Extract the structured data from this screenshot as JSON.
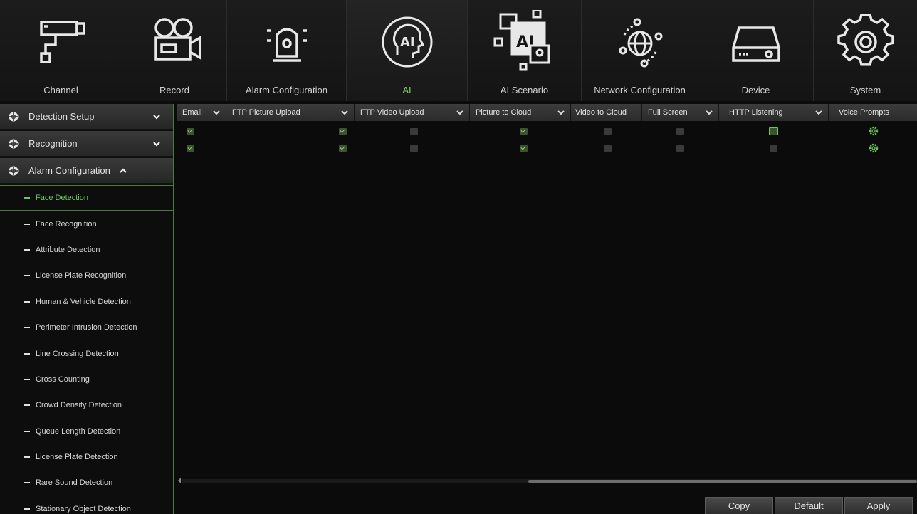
{
  "nav": {
    "items": [
      {
        "label": "Channel",
        "icon": "cctv-camera-icon"
      },
      {
        "label": "Record",
        "icon": "film-camera-icon"
      },
      {
        "label": "Alarm Configuration",
        "icon": "alarm-siren-icon"
      },
      {
        "label": "AI",
        "icon": "ai-head-icon",
        "active": true
      },
      {
        "label": "AI Scenario",
        "icon": "ai-scenario-icon"
      },
      {
        "label": "Network Configuration",
        "icon": "globe-network-icon"
      },
      {
        "label": "Device",
        "icon": "hard-drive-icon"
      },
      {
        "label": "System",
        "icon": "gear-icon"
      }
    ],
    "active_color": "#7fd36a"
  },
  "sidebar": {
    "sections": [
      {
        "label": "Detection Setup",
        "expanded": false
      },
      {
        "label": "Recognition",
        "expanded": false
      },
      {
        "label": "Alarm Configuration",
        "expanded": true
      }
    ],
    "items": [
      {
        "label": "Face Detection",
        "active": true
      },
      {
        "label": "Face Recognition"
      },
      {
        "label": "Attribute Detection"
      },
      {
        "label": "License Plate Recognition"
      },
      {
        "label": "Human & Vehicle Detection"
      },
      {
        "label": "Perimeter Intrusion Detection"
      },
      {
        "label": "Line Crossing Detection"
      },
      {
        "label": "Cross Counting"
      },
      {
        "label": "Crowd Density Detection"
      },
      {
        "label": "Queue Length Detection"
      },
      {
        "label": "License Plate Detection"
      },
      {
        "label": "Rare Sound Detection"
      },
      {
        "label": "Stationary Object Detection"
      }
    ]
  },
  "table": {
    "columns": [
      {
        "label": "Email",
        "dropdown": true
      },
      {
        "label": "FTP Picture Upload",
        "dropdown": true
      },
      {
        "label": "FTP Video Upload",
        "dropdown": true
      },
      {
        "label": "Picture to Cloud",
        "dropdown": true
      },
      {
        "label": "Video to Cloud",
        "dropdown": false
      },
      {
        "label": "Full Screen",
        "dropdown": true
      },
      {
        "label": "HTTP Listening",
        "dropdown": true
      },
      {
        "label": "Voice Prompts",
        "dropdown": false
      }
    ],
    "rows": [
      {
        "email": true,
        "ftp_picture": true,
        "ftp_video": false,
        "picture_cloud": true,
        "video_cloud": false,
        "full_screen": false,
        "http_listening": false,
        "voice_prompts": "settings"
      },
      {
        "email": true,
        "ftp_picture": true,
        "ftp_video": false,
        "picture_cloud": true,
        "video_cloud": false,
        "full_screen": false,
        "http_listening": false,
        "voice_prompts": "settings"
      }
    ],
    "settings_icon_color": "#6cc45a"
  },
  "buttons": {
    "copy": "Copy",
    "default": "Default",
    "apply": "Apply"
  }
}
